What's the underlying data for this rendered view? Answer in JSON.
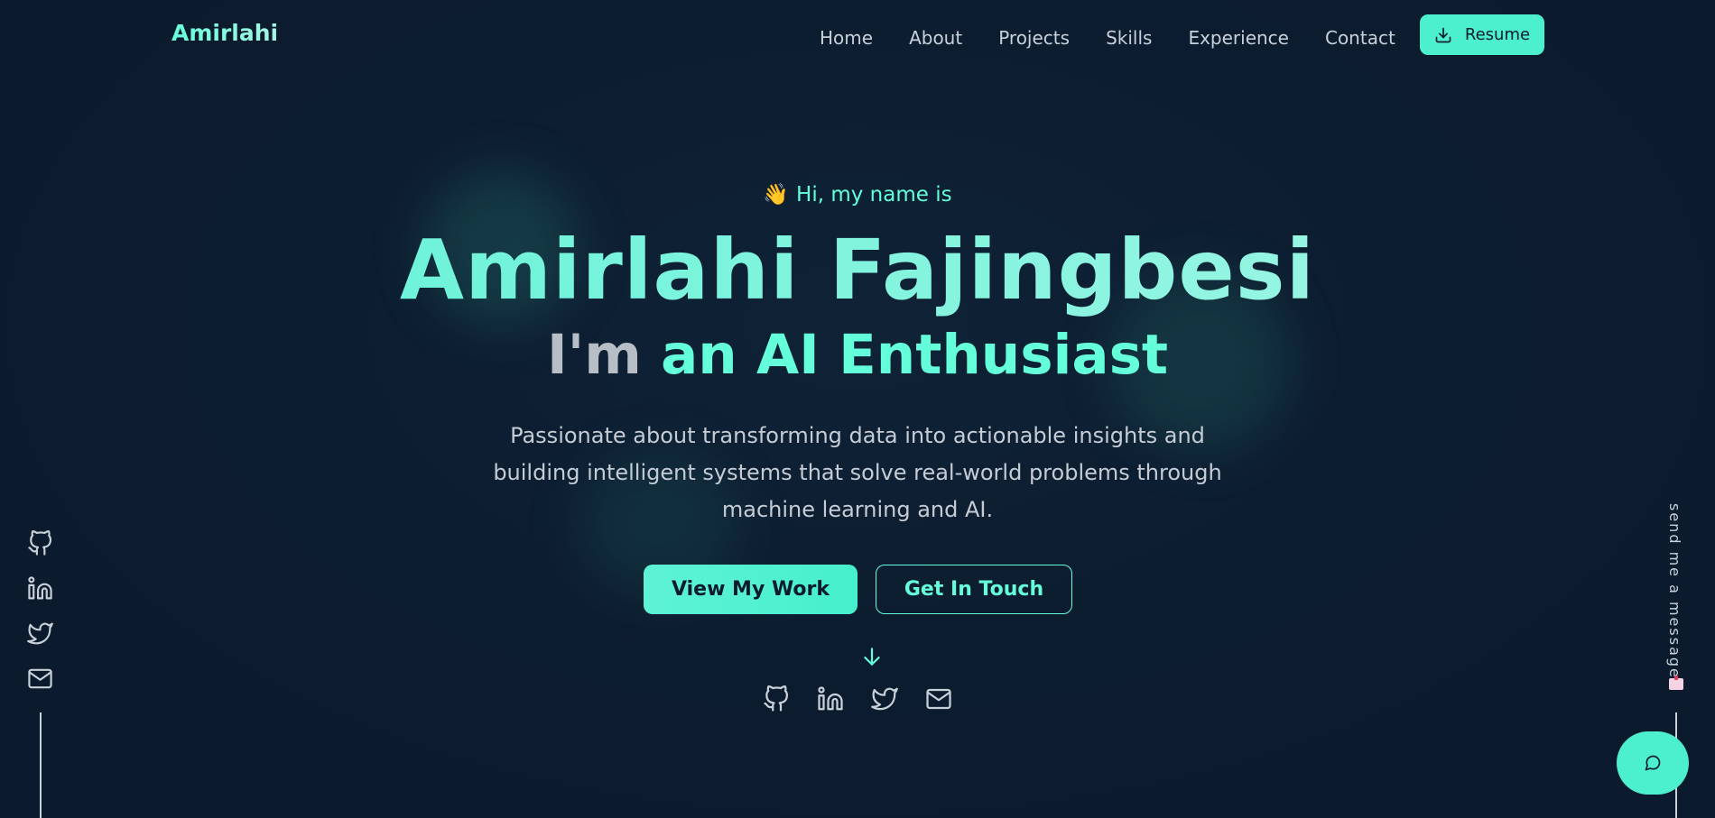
{
  "brand": "Amirlahi",
  "nav": {
    "items": [
      "Home",
      "About",
      "Projects",
      "Skills",
      "Experience",
      "Contact"
    ],
    "resume_label": "Resume"
  },
  "hero": {
    "wave_emoji": "👋",
    "greeting": "Hi, my name is",
    "name": "Amirlahi Fajingbesi",
    "role_prefix": "I'm",
    "role_accent": "an AI Enthusiast",
    "description": "Passionate about transforming data into actionable insights and building intelligent systems that solve real-world problems through machine learning and AI.",
    "primary_button": "View My Work",
    "secondary_button": "Get In Touch"
  },
  "social_icons": [
    "github-icon",
    "linkedin-icon",
    "twitter-icon",
    "mail-icon"
  ],
  "side_message": "send me a message",
  "colors": {
    "background": "#0c1b2e",
    "accent": "#64ffda",
    "text": "#c8d0d9"
  }
}
